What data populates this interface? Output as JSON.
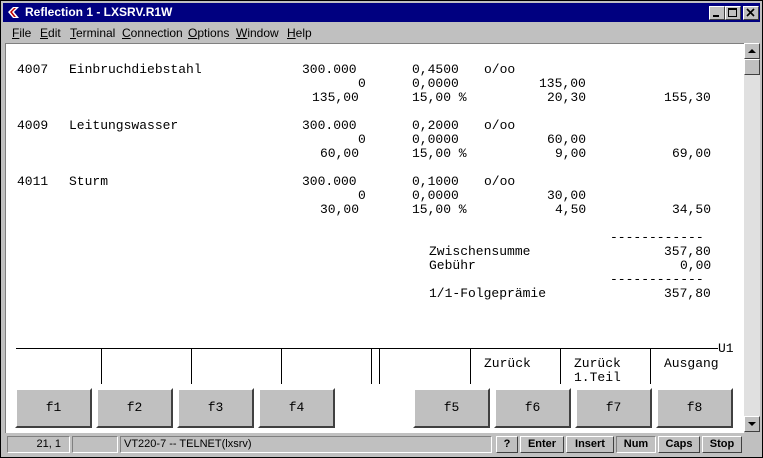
{
  "window": {
    "title": "Reflection 1 - LXSRV.R1W"
  },
  "menubar": [
    {
      "key": "F",
      "rest": "ile"
    },
    {
      "key": "E",
      "rest": "dit"
    },
    {
      "key": "T",
      "rest": "erminal"
    },
    {
      "key": "C",
      "rest": "onnection"
    },
    {
      "key": "O",
      "rest": "ptions"
    },
    {
      "key": "W",
      "rest": "indow"
    },
    {
      "key": "H",
      "rest": "elp"
    }
  ],
  "terminal": {
    "rows": [
      {
        "code": "4007",
        "name": "Einbruchdiebstahl",
        "sum": "300.000",
        "rate": "0,4500",
        "unit": "o/oo",
        "r2_a": "0",
        "r2_b": "0,0000",
        "r2_c": "135,00",
        "r3_a": "135,00",
        "r3_b": "15,00 %",
        "r3_c": "20,30",
        "r3_d": "155,30"
      },
      {
        "code": "4009",
        "name": "Leitungswasser",
        "sum": "300.000",
        "rate": "0,2000",
        "unit": "o/oo",
        "r2_a": "0",
        "r2_b": "0,0000",
        "r2_c": "60,00",
        "r3_a": "60,00",
        "r3_b": "15,00 %",
        "r3_c": "9,00",
        "r3_d": "69,00"
      },
      {
        "code": "4011",
        "name": "Sturm",
        "sum": "300.000",
        "rate": "0,1000",
        "unit": "o/oo",
        "r2_a": "0",
        "r2_b": "0,0000",
        "r2_c": "30,00",
        "r3_a": "30,00",
        "r3_b": "15,00 %",
        "r3_c": "4,50",
        "r3_d": "34,50"
      }
    ],
    "dashes": "------------",
    "subtotal_label": "Zwischensumme",
    "subtotal_value": "357,80",
    "fee_label": "Gebühr",
    "fee_value": "0,00",
    "premium_label": "1/1-Folgeprämie",
    "premium_value": "357,80",
    "screen_id": "U1",
    "softkey_labels": {
      "f6": "Zurück",
      "f7a": "Zurück",
      "f7b": "1.Teil",
      "f8": "Ausgang"
    }
  },
  "fkeys": [
    "f1",
    "f2",
    "f3",
    "f4",
    "f5",
    "f6",
    "f7",
    "f8"
  ],
  "statusbar": {
    "cursor": "21, 1",
    "empty": "",
    "connection": "VT220-7 -- TELNET(lxsrv)",
    "help": "?",
    "enter": "Enter",
    "insert": "Insert",
    "num": "Num",
    "caps": "Caps",
    "stop": "Stop"
  },
  "colors": {
    "titlebar": "#000080",
    "chrome": "#c0c0c0",
    "terminal_bg": "#ffffff"
  }
}
